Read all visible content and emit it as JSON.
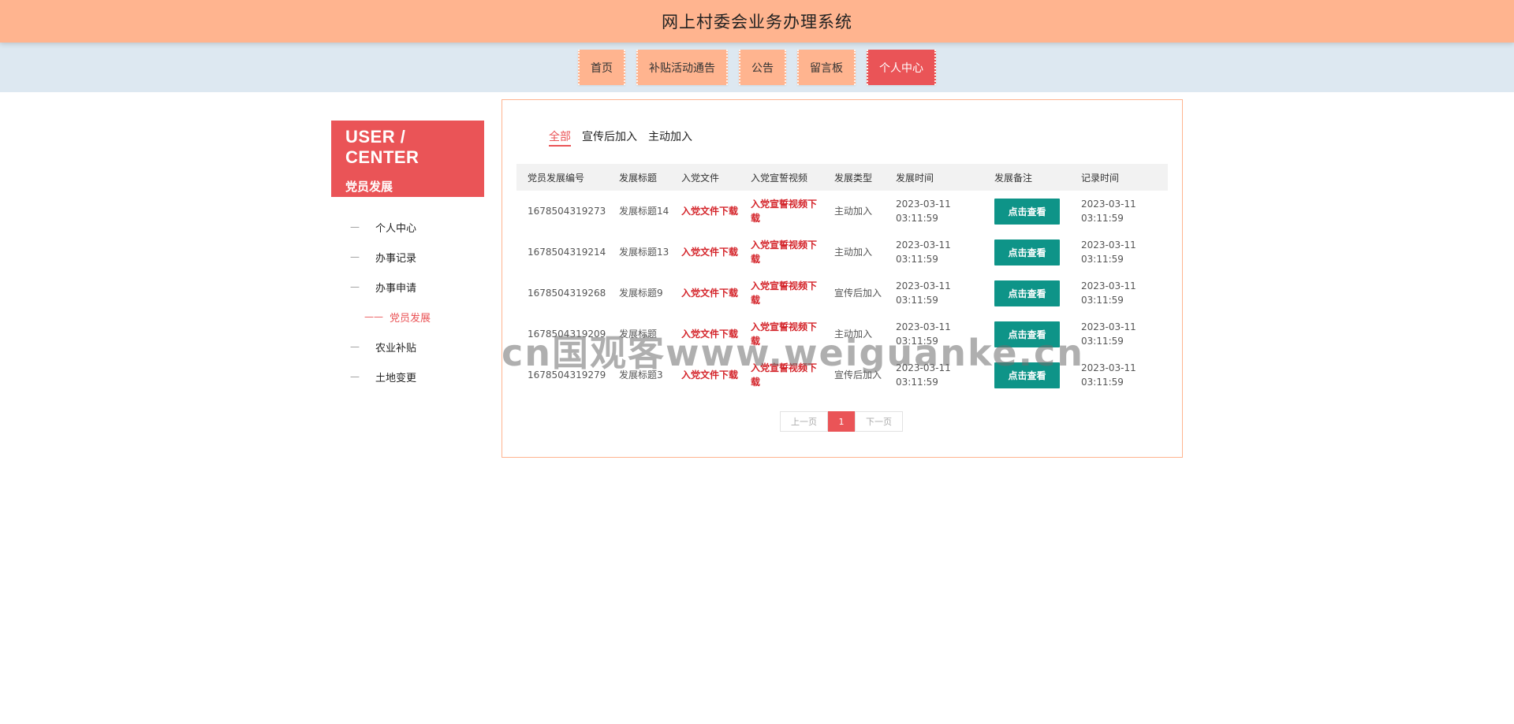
{
  "header": {
    "title": "网上村委会业务办理系统"
  },
  "nav": {
    "items": [
      {
        "label": "首页"
      },
      {
        "label": "补贴活动通告"
      },
      {
        "label": "公告"
      },
      {
        "label": "留言板"
      },
      {
        "label": "个人中心",
        "active": true
      }
    ]
  },
  "sidebar": {
    "title": "USER / CENTER",
    "subtitle": "党员发展",
    "dash": "—",
    "sub_dash": "——",
    "items": [
      {
        "label": "个人中心"
      },
      {
        "label": "办事记录"
      },
      {
        "label": "办事申请"
      },
      {
        "label": "党员发展",
        "sub": true,
        "active": true
      },
      {
        "label": "农业补贴"
      },
      {
        "label": "土地变更"
      }
    ]
  },
  "filter_tabs": [
    {
      "label": "全部",
      "active": true
    },
    {
      "label": "宣传后加入"
    },
    {
      "label": "主动加入"
    }
  ],
  "table": {
    "headers": [
      "党员发展编号",
      "发展标题",
      "入党文件",
      "入党宣誓视频",
      "发展类型",
      "发展时间",
      "发展备注",
      "记录时间"
    ],
    "rows": [
      {
        "id": "1678504319273",
        "title": "发展标题14",
        "file": "入党文件下载",
        "video": "入党宣誓视频下载",
        "type": "主动加入",
        "dev_time": "2023-03-11 03:11:59",
        "note": "点击查看",
        "rec_time": "2023-03-11 03:11:59"
      },
      {
        "id": "1678504319214",
        "title": "发展标题13",
        "file": "入党文件下载",
        "video": "入党宣誓视频下载",
        "type": "主动加入",
        "dev_time": "2023-03-11 03:11:59",
        "note": "点击查看",
        "rec_time": "2023-03-11 03:11:59"
      },
      {
        "id": "1678504319268",
        "title": "发展标题9",
        "file": "入党文件下载",
        "video": "入党宣誓视频下载",
        "type": "宣传后加入",
        "dev_time": "2023-03-11 03:11:59",
        "note": "点击查看",
        "rec_time": "2023-03-11 03:11:59"
      },
      {
        "id": "1678504319209",
        "title": "发展标题",
        "file": "入党文件下载",
        "video": "入党宣誓视频下载",
        "type": "主动加入",
        "dev_time": "2023-03-11 03:11:59",
        "note": "点击查看",
        "rec_time": "2023-03-11 03:11:59"
      },
      {
        "id": "1678504319279",
        "title": "发展标题3",
        "file": "入党文件下载",
        "video": "入党宣誓视频下载",
        "type": "宣传后加入",
        "dev_time": "2023-03-11 03:11:59",
        "note": "点击查看",
        "rec_time": "2023-03-11 03:11:59"
      }
    ]
  },
  "pagination": {
    "prev": "上一页",
    "current": "1",
    "next": "下一页"
  },
  "watermark": "cn国观客www.weiguanke.cn",
  "colors": {
    "header_bg": "#ffb48f",
    "nav_bg": "#dde8f1",
    "accent": "#ea5457",
    "button": "#0e9488",
    "link": "#d4242a"
  }
}
